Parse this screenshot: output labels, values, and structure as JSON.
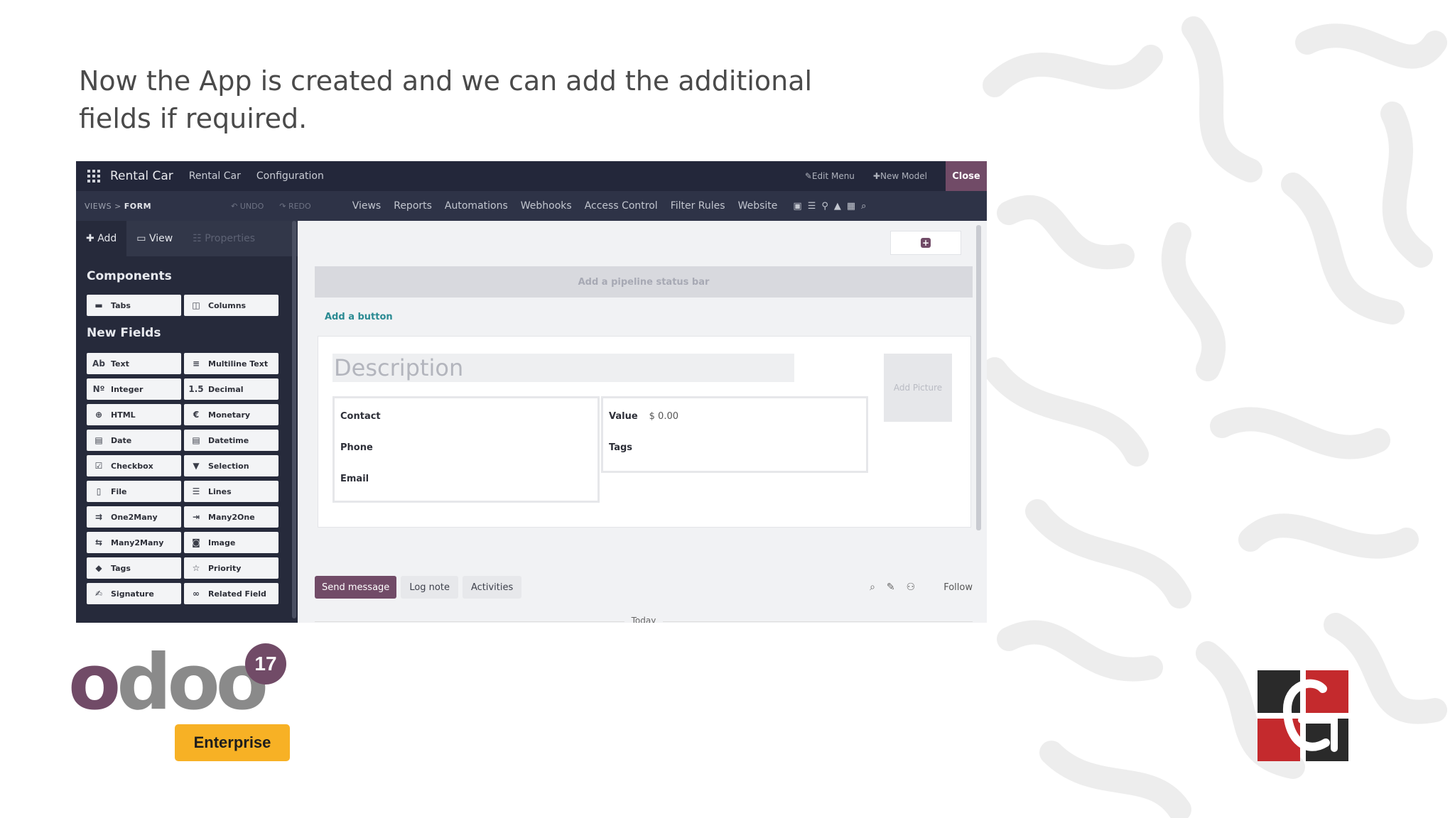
{
  "caption": "Now the App is created and we can add the additional fields if required.",
  "topbar": {
    "brand": "Rental Car",
    "menu_items": [
      "Rental Car",
      "Configuration"
    ],
    "edit_menu": "Edit Menu",
    "new_model": "New Model",
    "close": "Close"
  },
  "subbar": {
    "crumb_views": "VIEWS",
    "crumb_form": "FORM",
    "undo": "UNDO",
    "redo": "REDO",
    "tabs": [
      "Views",
      "Reports",
      "Automations",
      "Webhooks",
      "Access Control",
      "Filter Rules",
      "Website"
    ]
  },
  "sidebar": {
    "tab_add": "Add",
    "tab_view": "View",
    "tab_properties": "Properties",
    "components_title": "Components",
    "components": [
      {
        "icon": "tabs-icon",
        "label": "Tabs"
      },
      {
        "icon": "columns-icon",
        "label": "Columns"
      }
    ],
    "new_fields_title": "New Fields",
    "fields": [
      {
        "icon": "text-icon",
        "label": "Text"
      },
      {
        "icon": "multiline-icon",
        "label": "Multiline Text"
      },
      {
        "icon": "integer-icon",
        "label": "Integer"
      },
      {
        "icon": "decimal-icon",
        "label": "Decimal"
      },
      {
        "icon": "globe-icon",
        "label": "HTML"
      },
      {
        "icon": "euro-icon",
        "label": "Monetary"
      },
      {
        "icon": "calendar-icon",
        "label": "Date"
      },
      {
        "icon": "calendar-icon",
        "label": "Datetime"
      },
      {
        "icon": "checkbox-icon",
        "label": "Checkbox"
      },
      {
        "icon": "caret-down-icon",
        "label": "Selection"
      },
      {
        "icon": "file-icon",
        "label": "File"
      },
      {
        "icon": "list-icon",
        "label": "Lines"
      },
      {
        "icon": "one2many-icon",
        "label": "One2Many"
      },
      {
        "icon": "many2one-icon",
        "label": "Many2One"
      },
      {
        "icon": "many2many-icon",
        "label": "Many2Many"
      },
      {
        "icon": "camera-icon",
        "label": "Image"
      },
      {
        "icon": "tag-icon",
        "label": "Tags"
      },
      {
        "icon": "star-icon",
        "label": "Priority"
      },
      {
        "icon": "signature-icon",
        "label": "Signature"
      },
      {
        "icon": "link-icon",
        "label": "Related Field"
      }
    ]
  },
  "form": {
    "pipeline": "Add a pipeline status bar",
    "add_button": "Add a button",
    "description": "Description",
    "add_picture": "Add Picture",
    "contact": "Contact",
    "phone": "Phone",
    "email": "Email",
    "value_label": "Value",
    "value": "$ 0.00",
    "tags": "Tags"
  },
  "chatter": {
    "send_message": "Send message",
    "log_note": "Log note",
    "activities": "Activities",
    "follow": "Follow",
    "today": "Today"
  },
  "logo": {
    "wordmark": "odoo",
    "version": "17",
    "edition": "Enterprise"
  },
  "colors": {
    "brand_purple": "#714b67",
    "enterprise_yellow": "#f7b125",
    "navbar": "#23273a",
    "cybrosys_red": "#c42a2d"
  }
}
